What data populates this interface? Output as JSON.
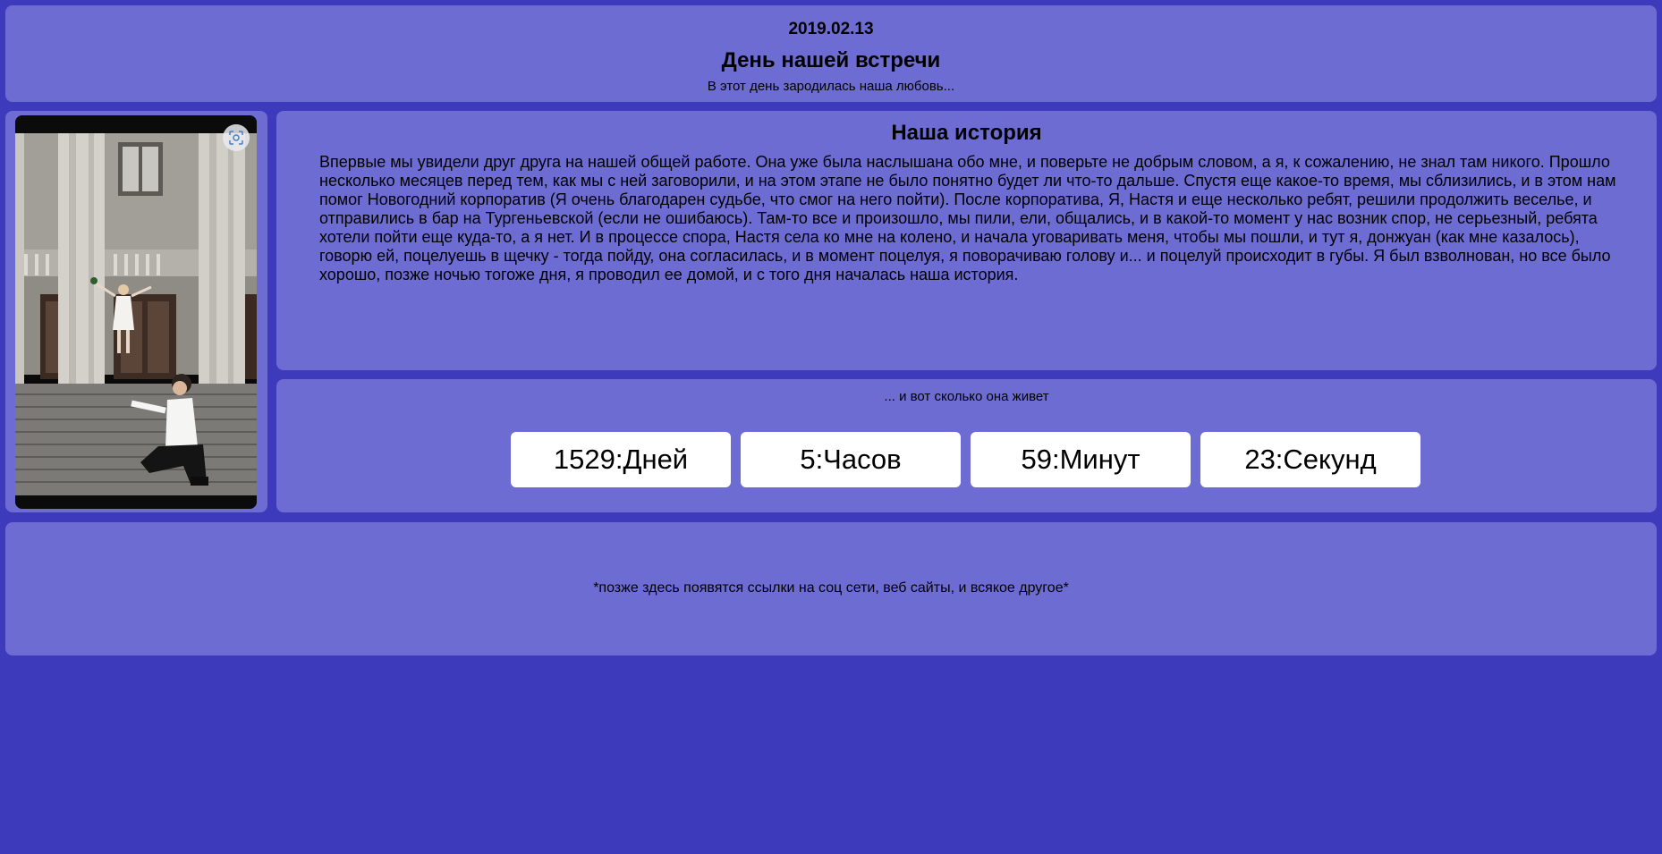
{
  "header": {
    "date": "2019.02.13",
    "title": "День нашей встречи",
    "subtitle": "В этот день зародилась наша любовь..."
  },
  "photo": {
    "icon": "camera-scan-icon"
  },
  "story": {
    "title": "Наша история",
    "text": "Впервые мы увидели друг друга на нашей общей работе. Она уже была наслышана обо мне, и поверьте не добрым словом, а я, к сожалению, не знал там никого. Прошло несколько месяцев перед тем, как мы с ней заговорили, и на этом этапе не было понятно будет ли что-то дальше. Спустя еще какое-то время, мы сблизились, и в этом нам помог Новогодний корпоратив (Я очень благодарен судьбе, что смог на него пойти). После корпоратива, Я, Настя и еще несколько ребят, решили продолжить веселье, и отправились в бар на Тургеньевской (если не ошибаюсь). Там-то все и произошло, мы пили, ели, общались, и в какой-то момент у нас возник спор, не серьезный, ребята хотели пойти еще куда-то, а я нет. И в процессе спора, Настя села ко мне на колено, и начала уговаривать меня, чтобы мы пошли, и тут я, донжуан (как мне казалось), говорю ей, поцелуешь в щечку - тогда пойду, она согласилась, и в момент поцелуя, я поворачиваю голову и... и поцелуй происходит в губы. Я был взволнован, но все было хорошо, позже ночью тогоже дня, я проводил ее домой, и с того дня началась наша история."
  },
  "counter": {
    "caption": "... и вот сколько она живет",
    "days": "1529:Дней",
    "hours": "5:Часов",
    "minutes": "59:Минут",
    "seconds": "23:Секунд"
  },
  "footer": {
    "note": "*позже здесь появятся ссылки на соц сети, веб сайты, и всякое другое*"
  },
  "colors": {
    "background": "#3d3bbb",
    "panel": "#6d6cd3",
    "box": "#ffffff"
  }
}
